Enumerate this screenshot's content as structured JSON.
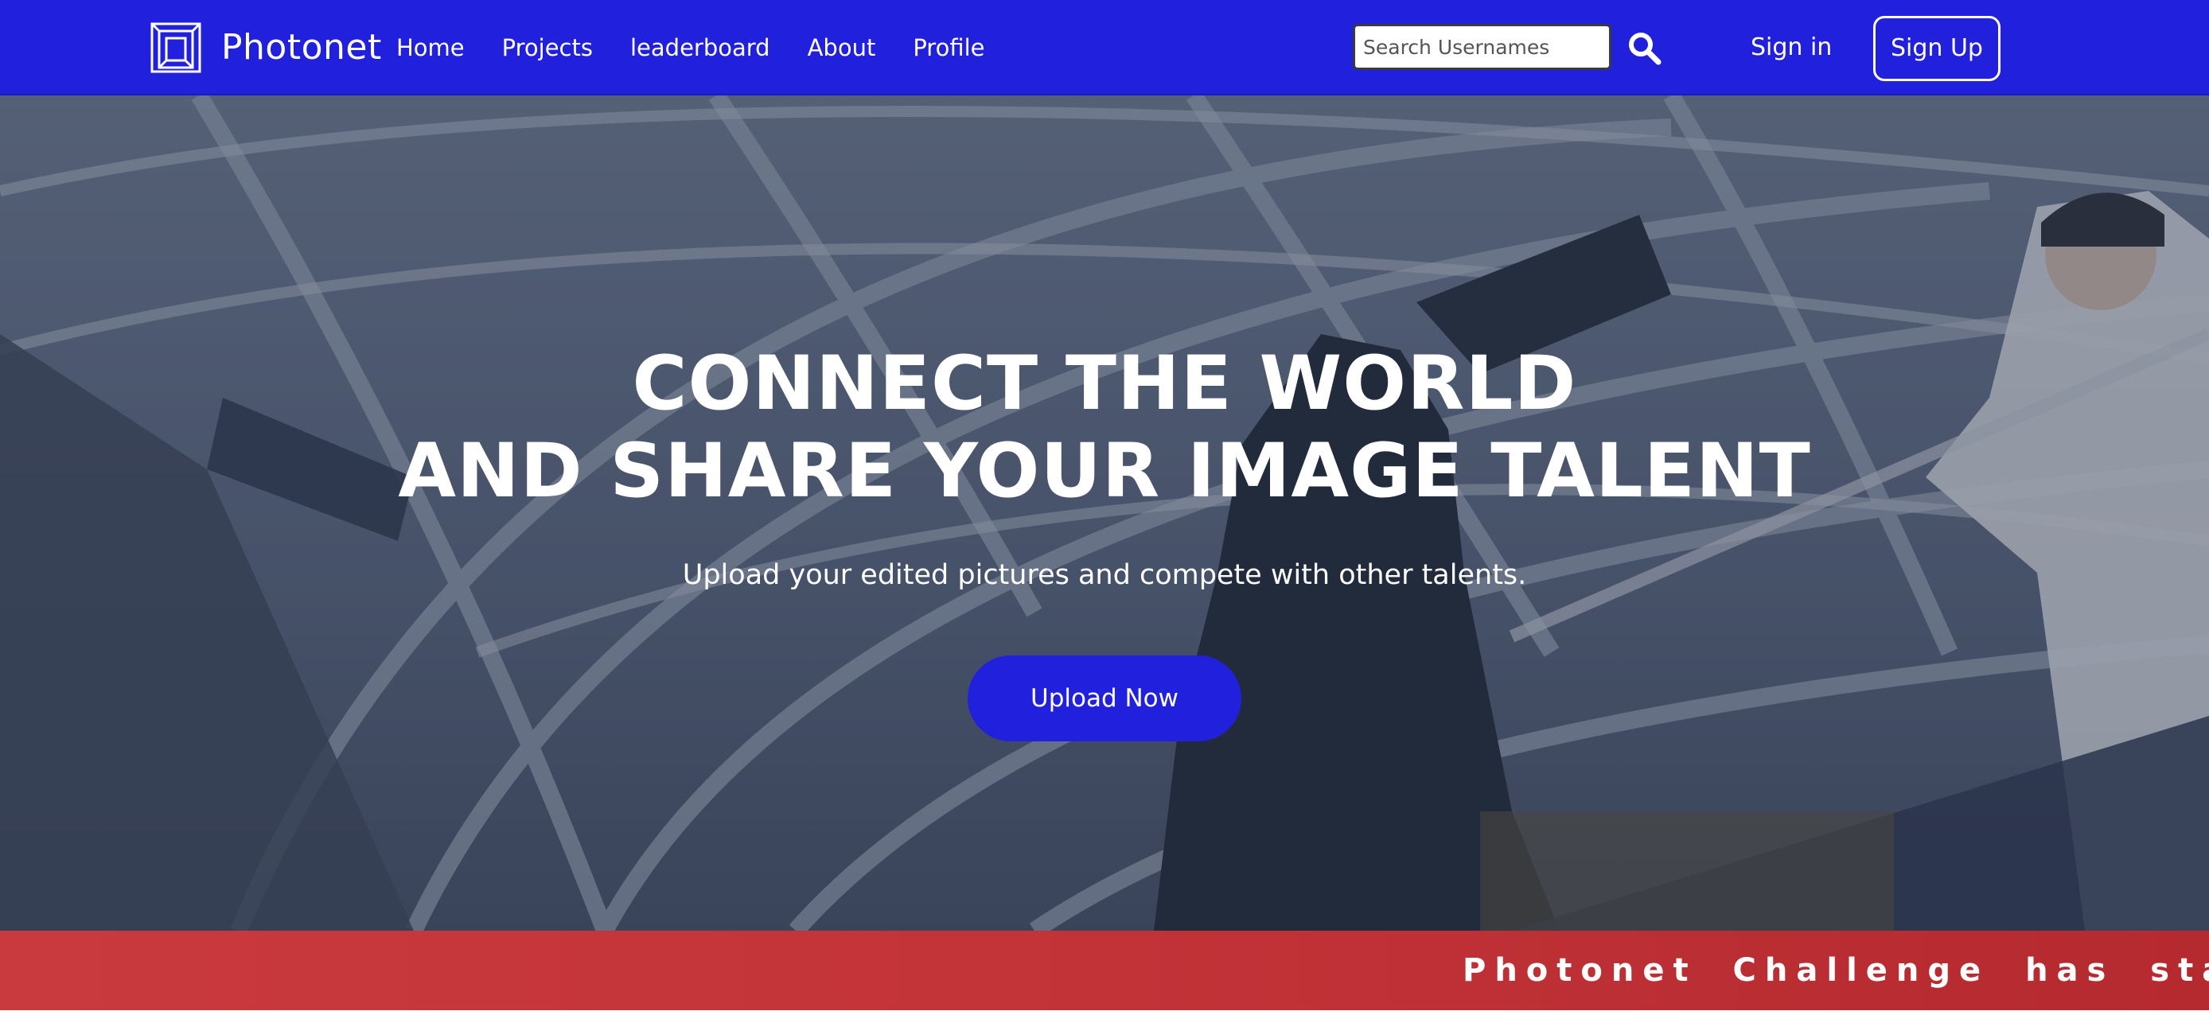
{
  "navbar": {
    "brand": "Photonet",
    "logo_icon": "photonet-logo-icon",
    "links": [
      "Home",
      "Projects",
      "leaderboard",
      "About",
      "Profile"
    ],
    "search": {
      "placeholder": "Search Usernames",
      "value": "",
      "icon": "search-icon"
    },
    "sign_in": "Sign in",
    "sign_up": "Sign Up"
  },
  "hero": {
    "title_line_1": "CONNECT THE WORLD",
    "title_line_2": "AND SHARE YOUR IMAGE TALENT",
    "subtitle": "Upload your edited pictures and compete with other talents.",
    "cta": "Upload Now",
    "background": "photo of people under a geodesic dome frame"
  },
  "ticker": {
    "text": "Photonet Challenge has start"
  },
  "colors": {
    "brand_blue": "#2020dd",
    "ticker_red": "#c23338",
    "text_white": "#ffffff"
  }
}
